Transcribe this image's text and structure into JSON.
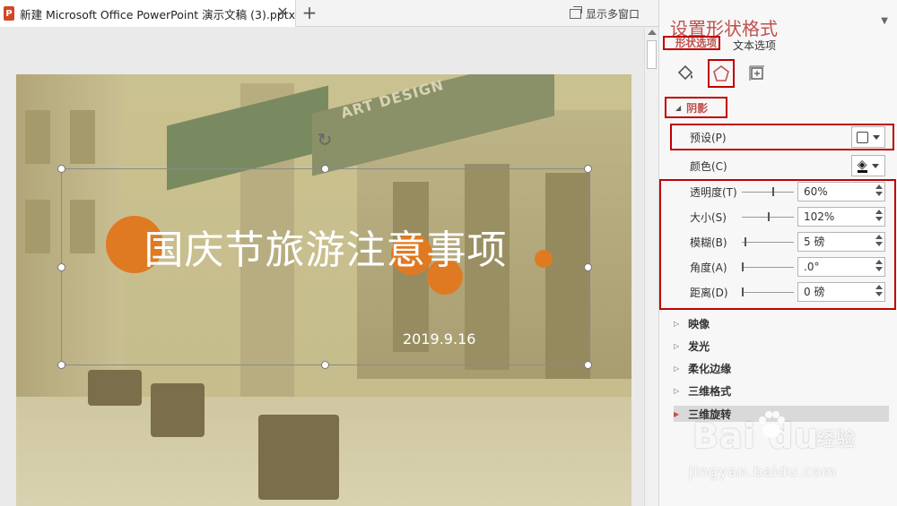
{
  "tab": {
    "icon_label": "P",
    "title": "新建 Microsoft Office PowerPoint 演示文稿 (3).pptx",
    "close": "✕",
    "add": "+"
  },
  "toolbar": {
    "multi_window": "显示多窗口"
  },
  "slide": {
    "title": "国庆节旅游注意事项",
    "date": "2019.9.16",
    "sign_text": "ART DESIGN",
    "rotate_glyph": "↻"
  },
  "pane": {
    "title": "设置形状格式",
    "tabs": [
      "形状选项",
      "文本选项"
    ],
    "icons": [
      "fill-line-icon",
      "effects-pentagon-icon",
      "size-properties-icon"
    ],
    "section": {
      "label": "阴影",
      "expanded": true
    },
    "preset_label": "预设(P)",
    "color_label": "颜色(C)",
    "sliders": [
      {
        "label": "透明度(T)",
        "value": "60%",
        "level": 0.6
      },
      {
        "label": "大小(S)",
        "value": "102%",
        "level": 0.51
      },
      {
        "label": "模糊(B)",
        "value": "5 磅",
        "level": 0.05
      },
      {
        "label": "角度(A)",
        "value": ".0°",
        "level": 0.0
      },
      {
        "label": "距离(D)",
        "value": "0 磅",
        "level": 0.0
      }
    ],
    "collapsed_sections": [
      "映像",
      "发光",
      "柔化边缘",
      "三维格式",
      "三维旋转"
    ]
  },
  "watermark": {
    "logo": "Bai du",
    "brand": "经验",
    "url": "jingyan.baidu.com"
  },
  "colors": {
    "accent": "#c0504d",
    "highlight_border": "#c00000",
    "dot": "#e07a22"
  }
}
